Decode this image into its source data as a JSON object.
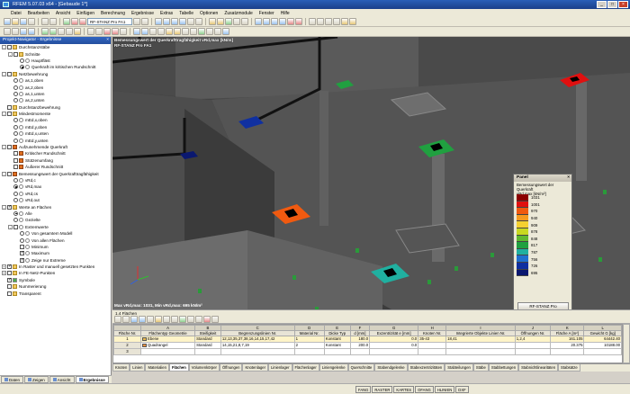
{
  "window": {
    "title": "RFEM 5.07.03 x64 - [Gebaude 1*]",
    "controls": [
      "_",
      "□",
      "×"
    ]
  },
  "menu": [
    "Datei",
    "Bearbeiten",
    "Ansicht",
    "Einfügen",
    "Berechnung",
    "Ergebnisse",
    "Extras",
    "Tabelle",
    "Optionen",
    "Zusatzmodule",
    "Fenster",
    "Hilfe"
  ],
  "toolbar2": {
    "module_combo": "RF-STANZ Pro   FA1"
  },
  "navigator": {
    "title": "Projekt-Navigator - Ergebnisse",
    "items": [
      {
        "label": "Durchstanzstäbe",
        "level": 0,
        "exp": "-",
        "kind": "chk",
        "on": false,
        "icon": "folder"
      },
      {
        "label": "Schnitte",
        "level": 1,
        "exp": "-",
        "kind": "chk",
        "on": false,
        "icon": "folder"
      },
      {
        "label": "Hauptfläst",
        "level": 2,
        "exp": "",
        "kind": "rad",
        "on": false,
        "icon": "dot"
      },
      {
        "label": "Querkraft im kritischen Rundschnitt",
        "level": 2,
        "exp": "",
        "kind": "rad",
        "on": true,
        "icon": "dot"
      },
      {
        "label": "Netzbewehrung",
        "level": 0,
        "exp": "-",
        "kind": "chk",
        "on": false,
        "icon": "folder"
      },
      {
        "label": "as,1,oben",
        "level": 1,
        "exp": "",
        "kind": "rad",
        "on": false,
        "icon": "dot"
      },
      {
        "label": "as,2,oben",
        "level": 1,
        "exp": "",
        "kind": "rad",
        "on": false,
        "icon": "dot"
      },
      {
        "label": "as,1,unten",
        "level": 1,
        "exp": "",
        "kind": "rad",
        "on": false,
        "icon": "dot"
      },
      {
        "label": "as,2,unten",
        "level": 1,
        "exp": "",
        "kind": "rad",
        "on": false,
        "icon": "dot"
      },
      {
        "label": "Durchstanzbewehrung",
        "level": 0,
        "exp": "",
        "kind": "chk",
        "on": false,
        "icon": "folder"
      },
      {
        "label": "Mindestmomente",
        "level": 0,
        "exp": "-",
        "kind": "chk",
        "on": false,
        "icon": "folder"
      },
      {
        "label": "mEd,x,oben",
        "level": 1,
        "exp": "",
        "kind": "rad",
        "on": false,
        "icon": "dot"
      },
      {
        "label": "mEd,y,oben",
        "level": 1,
        "exp": "",
        "kind": "rad",
        "on": false,
        "icon": "dot"
      },
      {
        "label": "mEd,x,unten",
        "level": 1,
        "exp": "",
        "kind": "rad",
        "on": false,
        "icon": "dot"
      },
      {
        "label": "mEd,y,unten",
        "level": 1,
        "exp": "",
        "kind": "rad",
        "on": false,
        "icon": "dot"
      },
      {
        "label": "Aufzunehmende Querkraft",
        "level": 0,
        "exp": "-",
        "kind": "chk",
        "on": false,
        "icon": "res"
      },
      {
        "label": "Kritischer Rundschnitt",
        "level": 1,
        "exp": "",
        "kind": "chk",
        "on": false,
        "icon": "res"
      },
      {
        "label": "Stützenumfang",
        "level": 1,
        "exp": "",
        "kind": "chk",
        "on": false,
        "icon": "res"
      },
      {
        "label": "Äußerer Rundschnitt",
        "level": 1,
        "exp": "",
        "kind": "chk",
        "on": false,
        "icon": "res"
      },
      {
        "label": "Bemessungswert der Querkrafttragfähigkeit",
        "level": 0,
        "exp": "-",
        "kind": "chk",
        "on": false,
        "icon": "res"
      },
      {
        "label": "vRd,c",
        "level": 1,
        "exp": "",
        "kind": "rad",
        "on": false,
        "icon": "dot"
      },
      {
        "label": "vRd,max",
        "level": 1,
        "exp": "",
        "kind": "rad",
        "on": true,
        "icon": "dot"
      },
      {
        "label": "vRd,cs",
        "level": 1,
        "exp": "",
        "kind": "rad",
        "on": false,
        "icon": "dot"
      },
      {
        "label": "vRd,out",
        "level": 1,
        "exp": "",
        "kind": "rad",
        "on": false,
        "icon": "dot"
      },
      {
        "label": "Werte an Flächen",
        "level": 0,
        "exp": "-",
        "kind": "chk",
        "on": true,
        "icon": "folder"
      },
      {
        "label": "Alle",
        "level": 1,
        "exp": "",
        "kind": "rad",
        "on": true,
        "icon": "dot"
      },
      {
        "label": "Gezielte",
        "level": 1,
        "exp": "",
        "kind": "rad",
        "on": false,
        "icon": "dot"
      },
      {
        "label": "Extremwerte",
        "level": 1,
        "exp": "-",
        "kind": "chk",
        "on": false,
        "icon": "dot"
      },
      {
        "label": "Von gesamtem Modell",
        "level": 2,
        "exp": "",
        "kind": "rad",
        "on": false,
        "icon": "dot"
      },
      {
        "label": "Von allen Flächen",
        "level": 2,
        "exp": "",
        "kind": "rad",
        "on": false,
        "icon": "dot"
      },
      {
        "label": "Minimum",
        "level": 2,
        "exp": "",
        "kind": "chk",
        "on": false,
        "icon": "dot"
      },
      {
        "label": "Maximum",
        "level": 2,
        "exp": "",
        "kind": "chk",
        "on": true,
        "icon": "dot"
      },
      {
        "label": "Zeige nur Extreme",
        "level": 2,
        "exp": "",
        "kind": "chk",
        "on": true,
        "icon": "dot"
      },
      {
        "label": "In Raster und manuell gesetzten Punkten",
        "level": 0,
        "exp": "+",
        "kind": "chk",
        "on": true,
        "icon": "folder"
      },
      {
        "label": "In FE-Netz-Punkten",
        "level": 0,
        "exp": "+",
        "kind": "chk",
        "on": false,
        "icon": "folder"
      },
      {
        "label": "Symbole",
        "level": 0,
        "exp": "",
        "kind": "chk",
        "on": true,
        "icon": "green"
      },
      {
        "label": "Nummerierung",
        "level": 0,
        "exp": "",
        "kind": "chk",
        "on": false,
        "icon": "folder"
      },
      {
        "label": "Transparent",
        "level": 0,
        "exp": "",
        "kind": "chk",
        "on": false,
        "icon": "folder"
      }
    ],
    "tabs": [
      "Daten",
      "Zeigen",
      "Ansicht",
      "Ergebnisse"
    ]
  },
  "viewport": {
    "info_lines": [
      "Bemessungswert der Querkrafttragfähigkeit vRd,max [kN/m]",
      "RF-STANZ Pro FA1"
    ],
    "footer": "Max vRd,max: 1031, Min vRd,max: 695 kN/m²"
  },
  "panel": {
    "title": "Panel",
    "subtitle": "Bemessungswert der Querkraft",
    "unit": "vRd,max [kN/m²]",
    "legend": [
      {
        "value": "1031",
        "color": "#8b0000"
      },
      {
        "value": "1001",
        "color": "#e01010"
      },
      {
        "value": "970",
        "color": "#f05a10"
      },
      {
        "value": "940",
        "color": "#f59a20"
      },
      {
        "value": "909",
        "color": "#f5d030"
      },
      {
        "value": "878",
        "color": "#c8d820"
      },
      {
        "value": "848",
        "color": "#60b830"
      },
      {
        "value": "817",
        "color": "#20a040"
      },
      {
        "value": "787",
        "color": "#20b0a0"
      },
      {
        "value": "756",
        "color": "#2070d0"
      },
      {
        "value": "726",
        "color": "#1030a0"
      },
      {
        "value": "695",
        "color": "#0a1870"
      }
    ],
    "button": "RF-STANZ Pro"
  },
  "table": {
    "title": "1.4 Flächen",
    "letters": [
      "",
      "A",
      "B",
      "C",
      "D",
      "E",
      "F",
      "G",
      "H",
      "I",
      "J",
      "K",
      "L"
    ],
    "headers": [
      "Fläche Nr.",
      "Flächentyp Geometrie",
      "Steifigkeit",
      "Begrenzungslinien Nr.",
      "Material Nr.",
      "Dicke Typ",
      "d [mm]",
      "Exzentrizität e [mm]",
      "Knoten Nr.",
      "Integrierte Objekte Linien Nr.",
      "Öffnungen Nr.",
      "Fläche A [m²]",
      "Gewicht G [kg]"
    ],
    "rows": [
      {
        "no": "1",
        "geom": "Ebene",
        "geom_color": "#e8b850",
        "stiff": "Standard",
        "lines": "12,13,35,37,38,16,14,15,17,42",
        "mat": "1",
        "thick": "Konstant",
        "d": "180.0",
        "e": "0.0",
        "nodes": "35-43",
        "lines2": "18,41",
        "openings": "1,2,4",
        "area": "161.105",
        "weight": "64442.40"
      },
      {
        "no": "2",
        "geom": "Quadrangel",
        "geom_color": "#e89040",
        "stiff": "Standard",
        "lines": "14,15,21,8,7,19",
        "mat": "2",
        "thick": "Konstant",
        "d": "200.0",
        "e": "0.0",
        "nodes": "",
        "lines2": "",
        "openings": "",
        "area": "20.375",
        "weight": "10188.00"
      },
      {
        "no": "3",
        "geom": "",
        "geom_color": "",
        "stiff": "",
        "lines": "",
        "mat": "",
        "thick": "",
        "d": "",
        "e": "",
        "nodes": "",
        "lines2": "",
        "openings": "",
        "area": "",
        "weight": ""
      }
    ]
  },
  "sheet_tabs": [
    "Knoten",
    "Linien",
    "Materialien",
    "Flächen",
    "Volumenkörper",
    "Öffnungen",
    "Knotenlager",
    "Linienlager",
    "Flächenlager",
    "Liniengelenke",
    "Querschnitte",
    "Stabendgelenke",
    "Stabexzentrizitäten",
    "Stabteilungen",
    "Stäbe",
    "Stabbettungen",
    "Stabnichtlinearitäten",
    "Stabsätze"
  ],
  "status": [
    "FANG",
    "RASTER",
    "KARTES",
    "OFANG",
    "HLINIEN",
    "DXF"
  ]
}
